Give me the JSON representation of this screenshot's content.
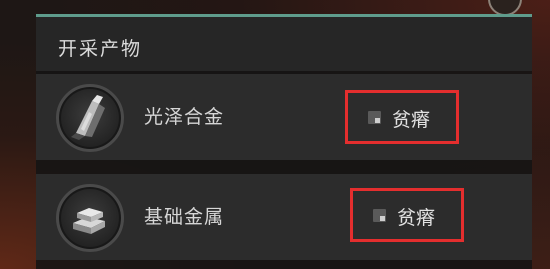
{
  "panel": {
    "title": "开采产物"
  },
  "resources": [
    {
      "name": "光泽合金",
      "quality": "贫瘠",
      "icon": "alloy-shard-icon"
    },
    {
      "name": "基础金属",
      "quality": "贫瘠",
      "icon": "metal-ingots-icon"
    }
  ],
  "colors": {
    "accent": "#5f9c8c",
    "highlight": "#e42e2e",
    "panel_bg": "#141414",
    "row_bg": "#2c2c2c"
  }
}
